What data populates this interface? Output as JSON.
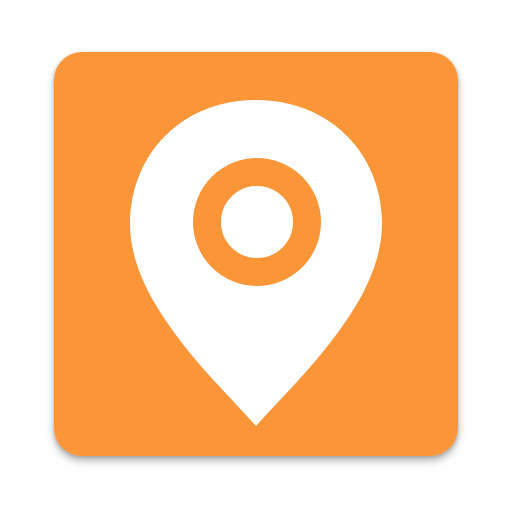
{
  "icon": {
    "name": "map-pin-icon",
    "background_color": "#FA9538",
    "pin_color": "#FFFFFF",
    "ring_color": "#FA9538"
  }
}
